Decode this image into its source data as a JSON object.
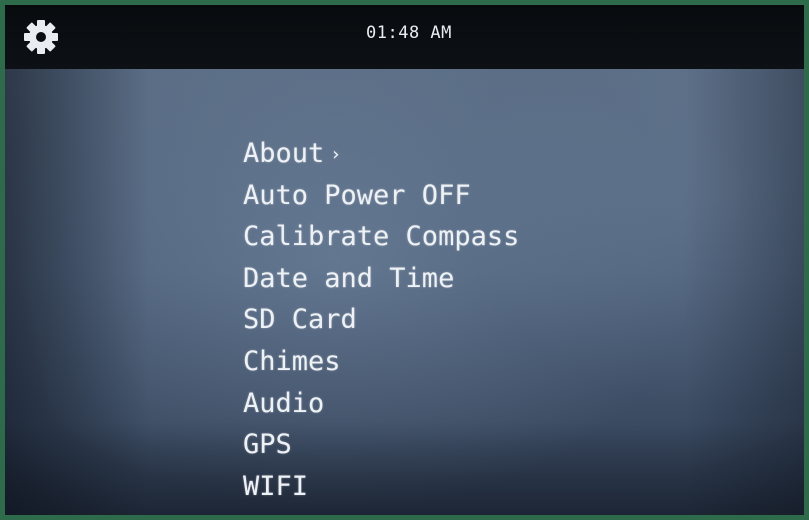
{
  "header": {
    "settings_icon": "gear-icon",
    "time": "01:48 AM"
  },
  "menu": {
    "items": [
      {
        "label": "About",
        "has_submenu": true,
        "chevron": "›"
      },
      {
        "label": "Auto Power OFF"
      },
      {
        "label": "Calibrate Compass"
      },
      {
        "label": "Date and Time"
      },
      {
        "label": "SD Card"
      },
      {
        "label": "Chimes"
      },
      {
        "label": "Audio"
      },
      {
        "label": "GPS"
      },
      {
        "label": "WIFI"
      }
    ]
  },
  "colors": {
    "frame_border": "#2e6b4a",
    "topbar": "#0a0d11",
    "screen": "#4d607a",
    "text": "#eef2f6"
  }
}
